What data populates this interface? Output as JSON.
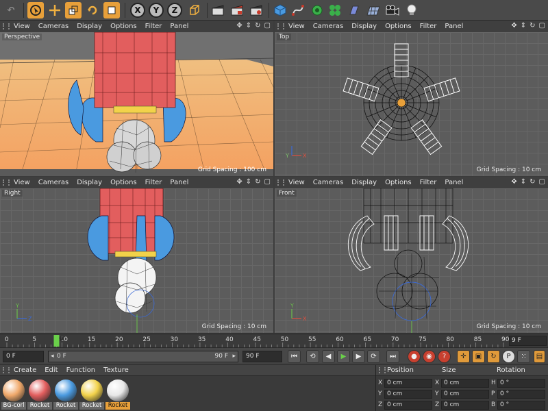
{
  "viewport_menu": [
    "View",
    "Cameras",
    "Display",
    "Options",
    "Filter",
    "Panel"
  ],
  "viewports": {
    "perspective": {
      "name": "Perspective",
      "grid_spacing": "Grid Spacing : 100 cm"
    },
    "top": {
      "name": "Top",
      "grid_spacing": "Grid Spacing : 10 cm"
    },
    "right": {
      "name": "Right",
      "grid_spacing": "Grid Spacing : 10 cm"
    },
    "front": {
      "name": "Front",
      "grid_spacing": "Grid Spacing : 10 cm"
    }
  },
  "toolbar": {
    "axis_x": "X",
    "axis_y": "Y",
    "axis_z": "Z"
  },
  "timeline": {
    "ticks": [
      "0",
      "5",
      "10",
      "15",
      "20",
      "25",
      "30",
      "35",
      "40",
      "45",
      "50",
      "55",
      "60",
      "65",
      "70",
      "75",
      "80",
      "85",
      "90"
    ],
    "current_frame_marker": "9",
    "end_frame_label": "9 F"
  },
  "playback": {
    "current_frame": "0 F",
    "range_start": "0 F",
    "range_end": "90 F",
    "max_frame": "90 F"
  },
  "material_menu": [
    "Create",
    "Edit",
    "Function",
    "Texture"
  ],
  "materials": [
    {
      "label": "BG-corl",
      "color": "#f0a86a",
      "selected": false
    },
    {
      "label": "Rocket",
      "color": "#e25e5e",
      "selected": false
    },
    {
      "label": "Rocket",
      "color": "#4a9ae0",
      "selected": false
    },
    {
      "label": "Rocket",
      "color": "#f2d24a",
      "selected": false
    },
    {
      "label": "Rocket",
      "color": "#e8e8e8",
      "selected": true
    }
  ],
  "coords": {
    "headers": {
      "position": "Position",
      "size": "Size",
      "rotation": "Rotation"
    },
    "rows": [
      {
        "axis": "X",
        "pos": "0 cm",
        "size_axis": "X",
        "size": "0 cm",
        "rot_axis": "H",
        "rot": "0 °"
      },
      {
        "axis": "Y",
        "pos": "0 cm",
        "size_axis": "Y",
        "size": "0 cm",
        "rot_axis": "P",
        "rot": "0 °"
      },
      {
        "axis": "Z",
        "pos": "0 cm",
        "size_axis": "Z",
        "size": "0 cm",
        "rot_axis": "B",
        "rot": "0 °"
      }
    ]
  },
  "colors": {
    "accent": "#e8a03a",
    "rocket_red": "#e25e5e",
    "fin_blue": "#4a9ae0",
    "band_yellow": "#f2d24a"
  }
}
